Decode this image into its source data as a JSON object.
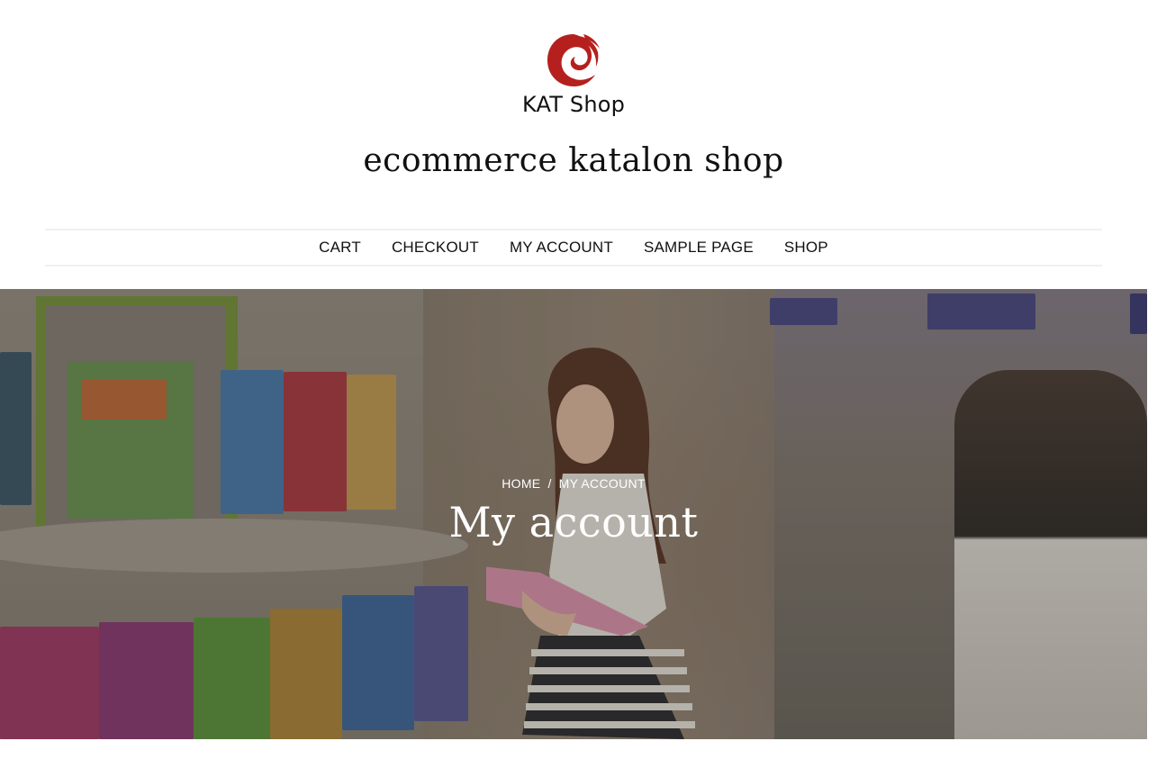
{
  "header": {
    "logo_text": "KAT Shop",
    "site_title": "ecommerce katalon shop"
  },
  "nav": {
    "items": [
      {
        "label": "CART"
      },
      {
        "label": "CHECKOUT"
      },
      {
        "label": "MY ACCOUNT"
      },
      {
        "label": "SAMPLE PAGE"
      },
      {
        "label": "SHOP"
      }
    ]
  },
  "hero": {
    "breadcrumb": {
      "home": "HOME",
      "separator": "/",
      "current": "MY ACCOUNT"
    },
    "title": "My account"
  },
  "scrollbar": {
    "up_icon": "scroll-up-arrow",
    "down_icon": "scroll-down-arrow"
  },
  "colors": {
    "logo_red": "#b5201e",
    "text": "#111111",
    "nav_border": "#f0f0f0",
    "hero_text": "#ffffff",
    "scroll_track": "#f1f1f1",
    "scroll_thumb": "#c1c1c1"
  }
}
